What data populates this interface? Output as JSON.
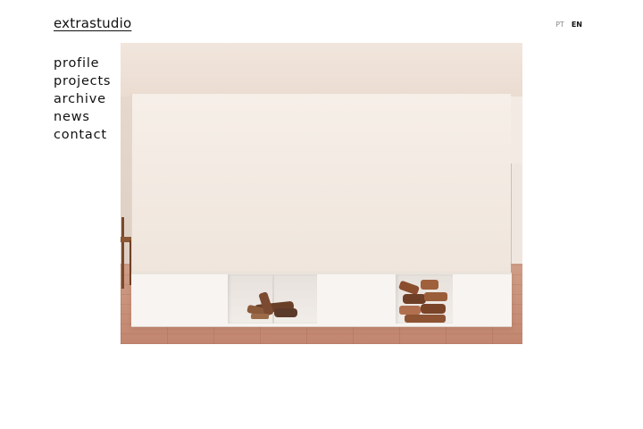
{
  "header": {
    "logo": "extrastudio",
    "languages": [
      {
        "label": "PT",
        "active": false
      },
      {
        "label": "EN",
        "active": true
      }
    ]
  },
  "nav": {
    "items": [
      {
        "label": "profile"
      },
      {
        "label": "projects"
      },
      {
        "label": "archive"
      },
      {
        "label": "news"
      },
      {
        "label": "contact"
      }
    ]
  },
  "hero": {
    "image": "interior-white-wall-firewood-photo"
  },
  "colors": {
    "background": "#ffffff",
    "text": "#111111",
    "inactive_lang": "#888888",
    "wall": "#f2e9e1",
    "floor_terracotta": "#c78c75"
  }
}
